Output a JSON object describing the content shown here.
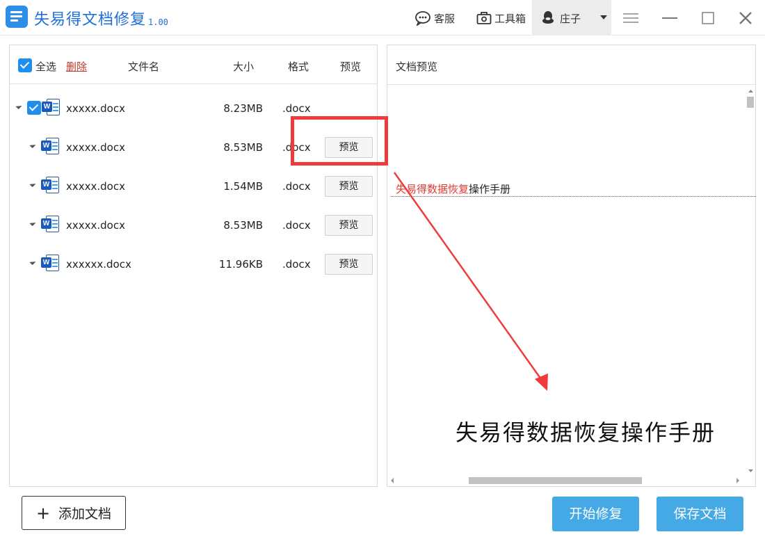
{
  "app": {
    "title": "失易得文档修复",
    "version": "1.00"
  },
  "toolbar": {
    "service_label": "客服",
    "toolbox_label": "工具箱",
    "user_name": "庄子"
  },
  "list": {
    "header": {
      "select_all": "全选",
      "delete": "删除",
      "col_name": "文件名",
      "col_size": "大小",
      "col_format": "格式",
      "col_preview": "预览"
    },
    "preview_label": "预览",
    "rows": [
      {
        "name": "xxxxx.docx",
        "size": "8.23MB",
        "format": ".docx",
        "checked": true,
        "has_preview": false
      },
      {
        "name": "xxxxx.docx",
        "size": "8.53MB",
        "format": ".docx",
        "checked": false,
        "has_preview": true
      },
      {
        "name": "xxxxx.docx",
        "size": "1.54MB",
        "format": ".docx",
        "checked": false,
        "has_preview": true
      },
      {
        "name": "xxxxx.docx",
        "size": "8.53MB",
        "format": ".docx",
        "checked": false,
        "has_preview": true
      },
      {
        "name": "xxxxxx.docx",
        "size": "11.96KB",
        "format": ".docx",
        "checked": false,
        "has_preview": true
      }
    ]
  },
  "preview_panel": {
    "title": "文档预览",
    "doc_line_red": "失易得数据恢复",
    "doc_line_rest": "操作手册",
    "caption": "失易得数据恢复操作手册"
  },
  "buttons": {
    "add_doc": "添加文档",
    "start_repair": "开始修复",
    "save_doc": "保存文档"
  },
  "colors": {
    "accent": "#45a9e6",
    "title_blue": "#1f6fd8",
    "annotation_red": "#ef3b3b",
    "delete_red": "#c0392b"
  }
}
